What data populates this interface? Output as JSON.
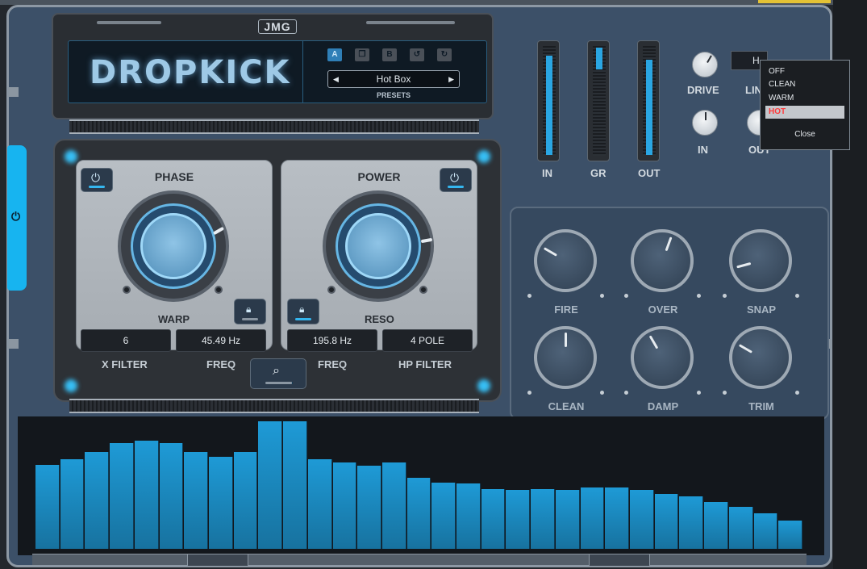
{
  "app": {
    "brand_logo": "JMG",
    "title": "DROPKICK"
  },
  "presets": {
    "buttons": [
      "A",
      "",
      "B",
      "",
      ""
    ],
    "current": "Hot Box",
    "label": "PRESETS"
  },
  "filter": {
    "left": {
      "title": "PHASE",
      "knob_label": "WARP"
    },
    "right": {
      "title": "POWER",
      "knob_label": "RESO"
    },
    "values": [
      {
        "value": "6",
        "label": "X FILTER"
      },
      {
        "value": "45.49 Hz",
        "label": "FREQ"
      },
      {
        "value": "195.8 Hz",
        "label": "FREQ"
      },
      {
        "value": "4 POLE",
        "label": "HP FILTER"
      }
    ]
  },
  "meters": [
    {
      "label": "IN",
      "level": 0.92
    },
    {
      "label": "GR",
      "level": 0.2
    },
    {
      "label": "OUT",
      "level": 0.88
    }
  ],
  "drive": {
    "label": "DRIVE"
  },
  "in_knob": {
    "label": "IN"
  },
  "lim": {
    "label": "LIN"
  },
  "out_knob": {
    "label": "OUT"
  },
  "mode": {
    "value": "H"
  },
  "dropdown": {
    "options": [
      "OFF",
      "CLEAN",
      "WARM",
      "HOT"
    ],
    "selected": "HOT",
    "close_label": "Close"
  },
  "knobs": [
    "FIRE",
    "OVER",
    "SNAP",
    "CLEAN",
    "DAMP",
    "TRIM"
  ],
  "spectrum": {
    "levels": [
      0.66,
      0.7,
      0.76,
      0.83,
      0.85,
      0.83,
      0.76,
      0.72,
      0.76,
      1.0,
      1.0,
      0.7,
      0.68,
      0.65,
      0.68,
      0.56,
      0.52,
      0.51,
      0.47,
      0.46,
      0.47,
      0.46,
      0.48,
      0.48,
      0.46,
      0.43,
      0.41,
      0.37,
      0.33,
      0.28,
      0.22
    ]
  },
  "colors": {
    "accent": "#2aa6e2",
    "sidetab": "#17b4f0",
    "selected_option": "#ff3a3a"
  }
}
